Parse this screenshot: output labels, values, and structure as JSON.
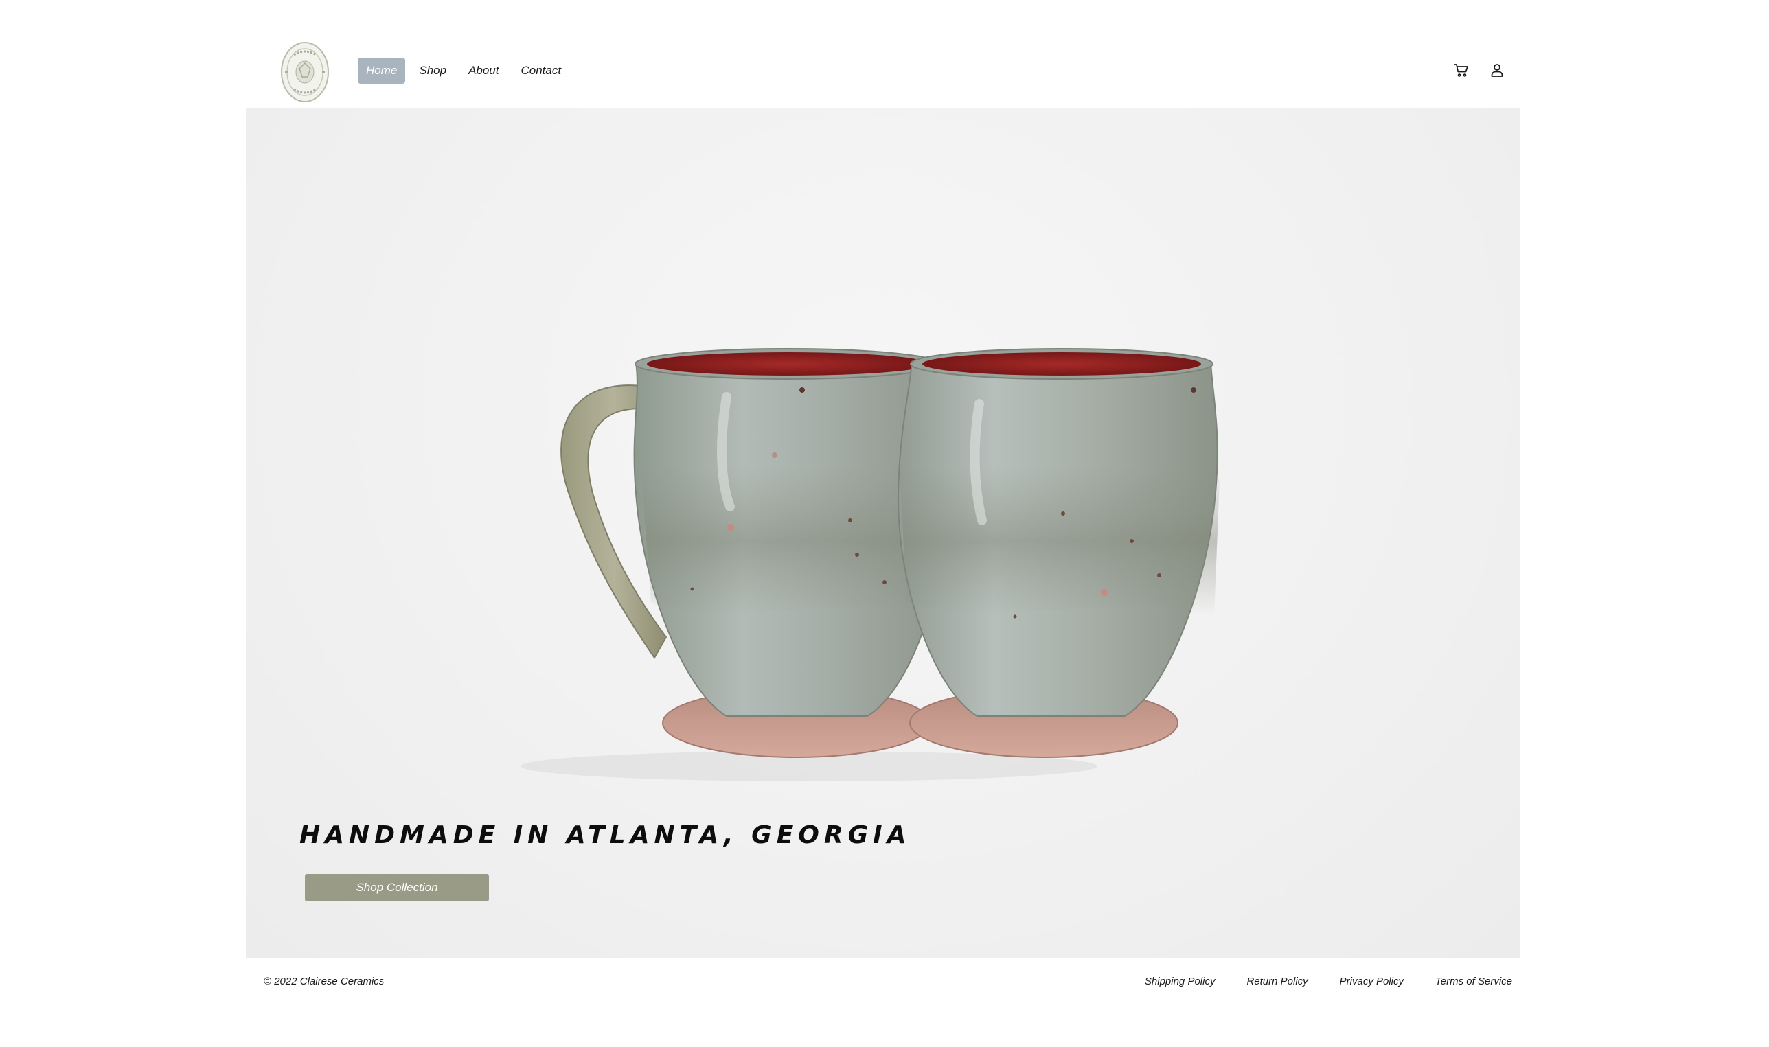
{
  "brand": {
    "logo_text_top": "CLAIRESE",
    "logo_text_bottom": "CERAMICS"
  },
  "nav": {
    "items": [
      {
        "label": "Home",
        "active": true
      },
      {
        "label": "Shop",
        "active": false
      },
      {
        "label": "About",
        "active": false
      },
      {
        "label": "Contact",
        "active": false
      }
    ]
  },
  "header_icons": {
    "cart": "cart-icon",
    "account": "user-icon"
  },
  "hero": {
    "title": "HANDMADE IN ATLANTA, GEORGIA",
    "button_label": "Shop Collection",
    "image": "two-ceramic-mugs"
  },
  "footer": {
    "copyright": "© 2022 Clairese Ceramics",
    "links": [
      "Shipping Policy",
      "Return Policy",
      "Privacy Policy",
      "Terms of Service"
    ]
  },
  "colors": {
    "nav_active_bg": "#aab4be",
    "button_bg": "#9a9b86",
    "glaze": "#9ea79f",
    "interior": "#8a1c1e",
    "foot": "#c99a8c"
  }
}
